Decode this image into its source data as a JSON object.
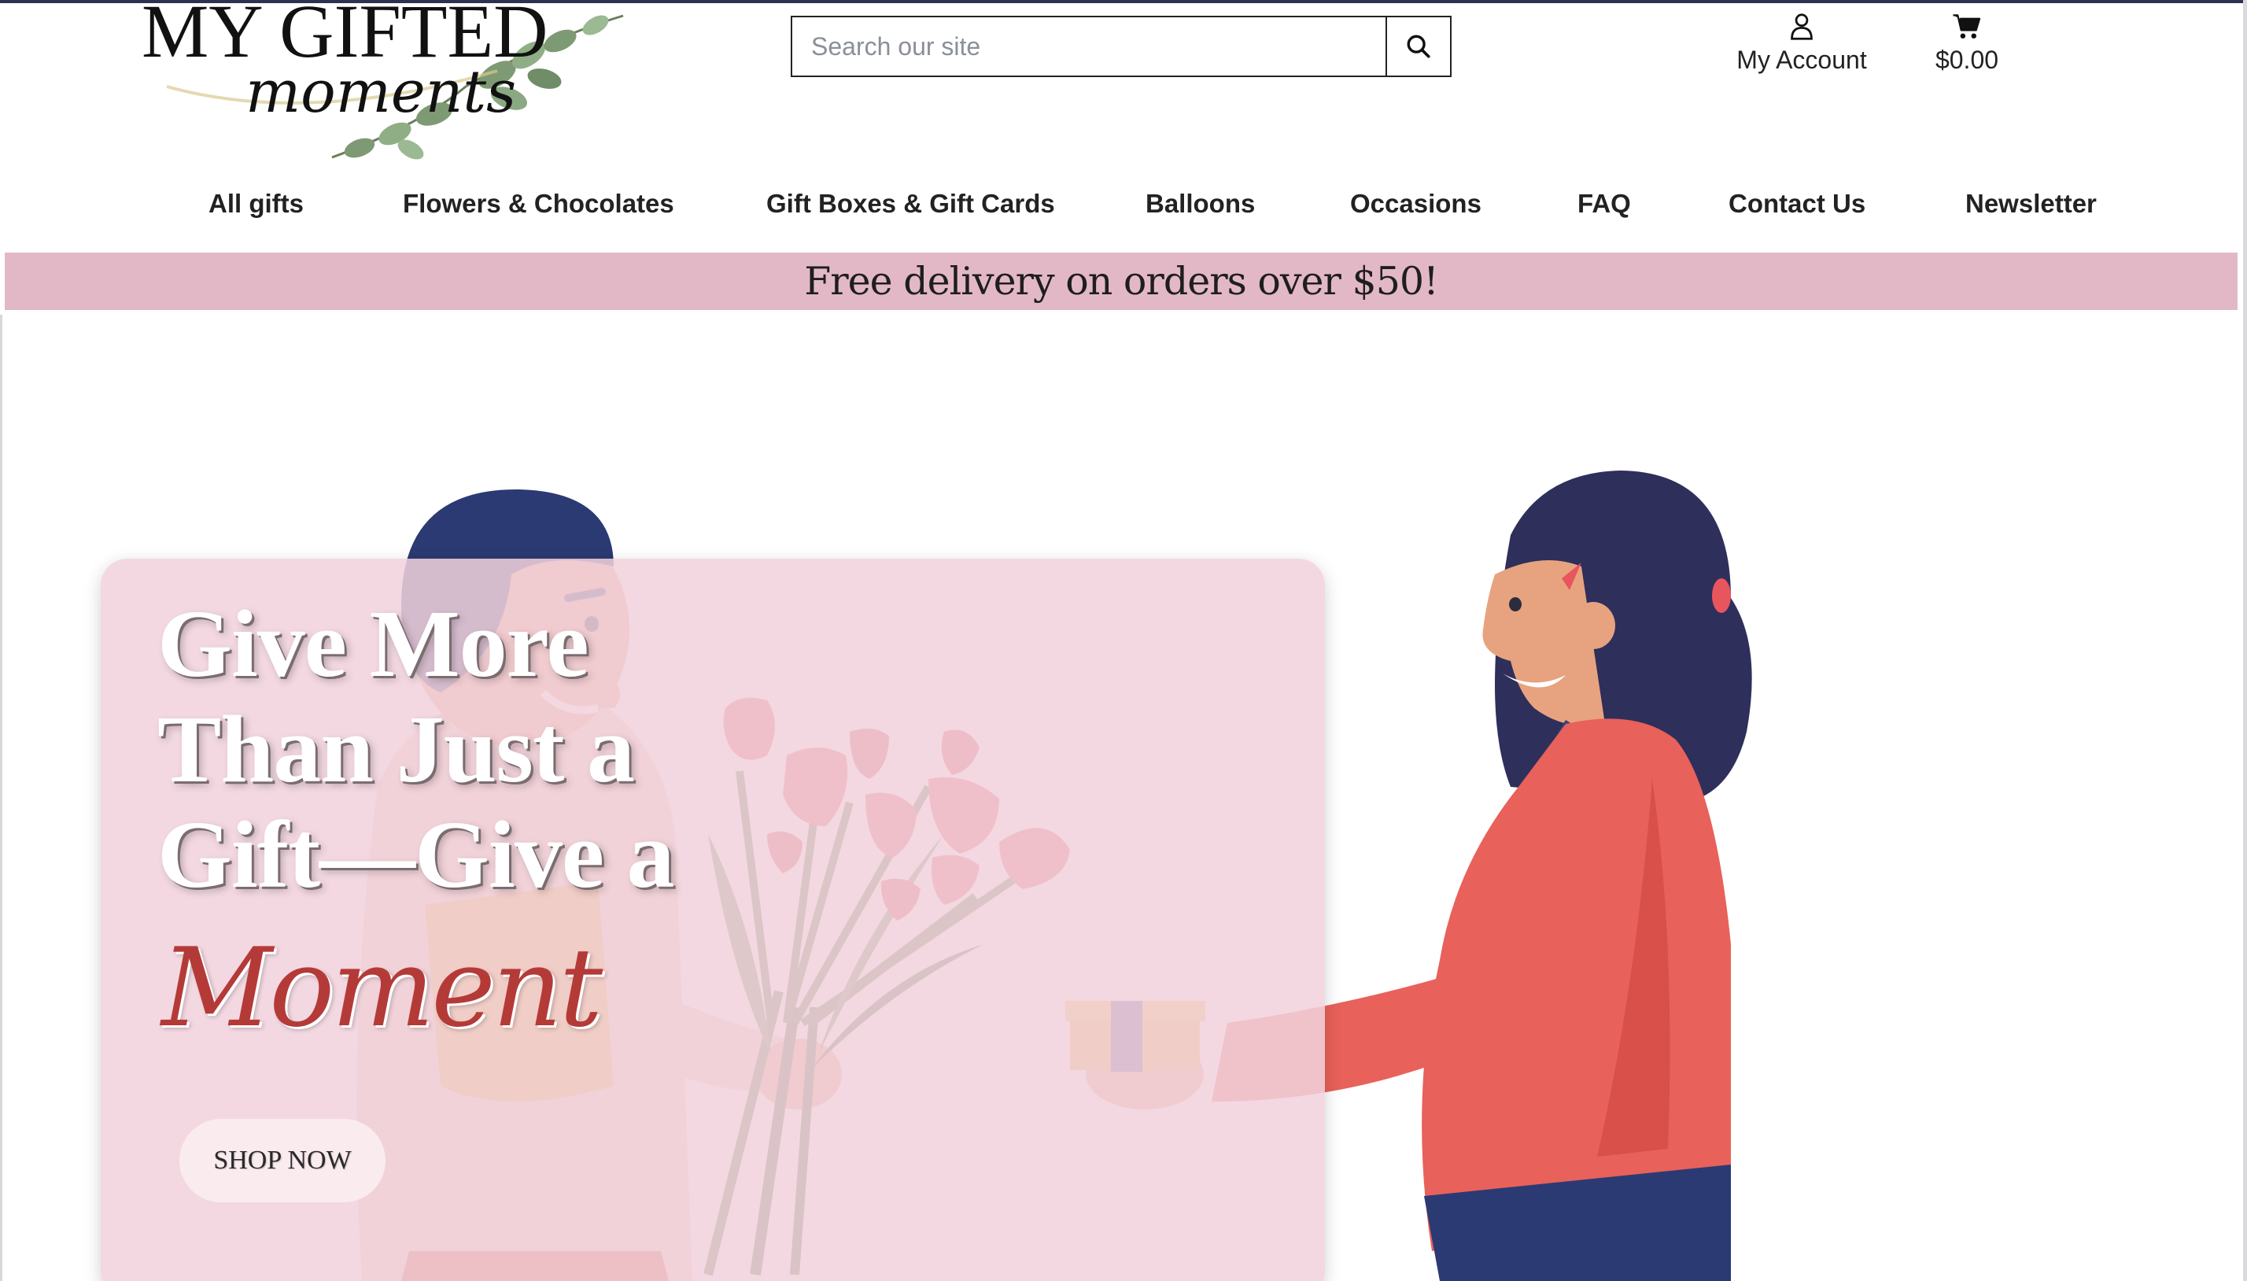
{
  "logo": {
    "line1": "MY GIFTED",
    "line2": "moments"
  },
  "search": {
    "placeholder": "Search our site"
  },
  "account": {
    "label": "My Account"
  },
  "cart": {
    "total": "$0.00"
  },
  "nav": {
    "items": [
      {
        "label": "All gifts"
      },
      {
        "label": "Flowers & Chocolates"
      },
      {
        "label": "Gift Boxes & Gift Cards"
      },
      {
        "label": "Balloons"
      },
      {
        "label": "Occasions"
      },
      {
        "label": "FAQ"
      },
      {
        "label": "Contact Us"
      },
      {
        "label": "Newsletter"
      }
    ]
  },
  "banner": {
    "text": "Free delivery on orders over $50!"
  },
  "hero": {
    "headline_lines": [
      "Give More",
      "Than Just a",
      "Gift—Give a"
    ],
    "accent": "Moment",
    "cta": "SHOP NOW"
  },
  "colors": {
    "banner_bg": "#e3b8c6",
    "accent_red": "#b43a38",
    "card_pink": "#f1d2dc",
    "navy": "#2c3350"
  }
}
